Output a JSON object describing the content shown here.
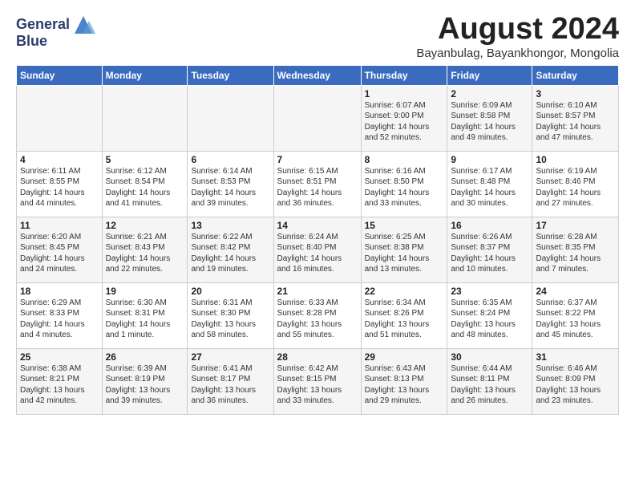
{
  "logo": {
    "general": "General",
    "blue": "Blue"
  },
  "header": {
    "month_year": "August 2024",
    "location": "Bayanbulag, Bayankhongor, Mongolia"
  },
  "days_of_week": [
    "Sunday",
    "Monday",
    "Tuesday",
    "Wednesday",
    "Thursday",
    "Friday",
    "Saturday"
  ],
  "weeks": [
    [
      {
        "day": "",
        "info": ""
      },
      {
        "day": "",
        "info": ""
      },
      {
        "day": "",
        "info": ""
      },
      {
        "day": "",
        "info": ""
      },
      {
        "day": "1",
        "info": "Sunrise: 6:07 AM\nSunset: 9:00 PM\nDaylight: 14 hours\nand 52 minutes."
      },
      {
        "day": "2",
        "info": "Sunrise: 6:09 AM\nSunset: 8:58 PM\nDaylight: 14 hours\nand 49 minutes."
      },
      {
        "day": "3",
        "info": "Sunrise: 6:10 AM\nSunset: 8:57 PM\nDaylight: 14 hours\nand 47 minutes."
      }
    ],
    [
      {
        "day": "4",
        "info": "Sunrise: 6:11 AM\nSunset: 8:55 PM\nDaylight: 14 hours\nand 44 minutes."
      },
      {
        "day": "5",
        "info": "Sunrise: 6:12 AM\nSunset: 8:54 PM\nDaylight: 14 hours\nand 41 minutes."
      },
      {
        "day": "6",
        "info": "Sunrise: 6:14 AM\nSunset: 8:53 PM\nDaylight: 14 hours\nand 39 minutes."
      },
      {
        "day": "7",
        "info": "Sunrise: 6:15 AM\nSunset: 8:51 PM\nDaylight: 14 hours\nand 36 minutes."
      },
      {
        "day": "8",
        "info": "Sunrise: 6:16 AM\nSunset: 8:50 PM\nDaylight: 14 hours\nand 33 minutes."
      },
      {
        "day": "9",
        "info": "Sunrise: 6:17 AM\nSunset: 8:48 PM\nDaylight: 14 hours\nand 30 minutes."
      },
      {
        "day": "10",
        "info": "Sunrise: 6:19 AM\nSunset: 8:46 PM\nDaylight: 14 hours\nand 27 minutes."
      }
    ],
    [
      {
        "day": "11",
        "info": "Sunrise: 6:20 AM\nSunset: 8:45 PM\nDaylight: 14 hours\nand 24 minutes."
      },
      {
        "day": "12",
        "info": "Sunrise: 6:21 AM\nSunset: 8:43 PM\nDaylight: 14 hours\nand 22 minutes."
      },
      {
        "day": "13",
        "info": "Sunrise: 6:22 AM\nSunset: 8:42 PM\nDaylight: 14 hours\nand 19 minutes."
      },
      {
        "day": "14",
        "info": "Sunrise: 6:24 AM\nSunset: 8:40 PM\nDaylight: 14 hours\nand 16 minutes."
      },
      {
        "day": "15",
        "info": "Sunrise: 6:25 AM\nSunset: 8:38 PM\nDaylight: 14 hours\nand 13 minutes."
      },
      {
        "day": "16",
        "info": "Sunrise: 6:26 AM\nSunset: 8:37 PM\nDaylight: 14 hours\nand 10 minutes."
      },
      {
        "day": "17",
        "info": "Sunrise: 6:28 AM\nSunset: 8:35 PM\nDaylight: 14 hours\nand 7 minutes."
      }
    ],
    [
      {
        "day": "18",
        "info": "Sunrise: 6:29 AM\nSunset: 8:33 PM\nDaylight: 14 hours\nand 4 minutes."
      },
      {
        "day": "19",
        "info": "Sunrise: 6:30 AM\nSunset: 8:31 PM\nDaylight: 14 hours\nand 1 minute."
      },
      {
        "day": "20",
        "info": "Sunrise: 6:31 AM\nSunset: 8:30 PM\nDaylight: 13 hours\nand 58 minutes."
      },
      {
        "day": "21",
        "info": "Sunrise: 6:33 AM\nSunset: 8:28 PM\nDaylight: 13 hours\nand 55 minutes."
      },
      {
        "day": "22",
        "info": "Sunrise: 6:34 AM\nSunset: 8:26 PM\nDaylight: 13 hours\nand 51 minutes."
      },
      {
        "day": "23",
        "info": "Sunrise: 6:35 AM\nSunset: 8:24 PM\nDaylight: 13 hours\nand 48 minutes."
      },
      {
        "day": "24",
        "info": "Sunrise: 6:37 AM\nSunset: 8:22 PM\nDaylight: 13 hours\nand 45 minutes."
      }
    ],
    [
      {
        "day": "25",
        "info": "Sunrise: 6:38 AM\nSunset: 8:21 PM\nDaylight: 13 hours\nand 42 minutes."
      },
      {
        "day": "26",
        "info": "Sunrise: 6:39 AM\nSunset: 8:19 PM\nDaylight: 13 hours\nand 39 minutes."
      },
      {
        "day": "27",
        "info": "Sunrise: 6:41 AM\nSunset: 8:17 PM\nDaylight: 13 hours\nand 36 minutes."
      },
      {
        "day": "28",
        "info": "Sunrise: 6:42 AM\nSunset: 8:15 PM\nDaylight: 13 hours\nand 33 minutes."
      },
      {
        "day": "29",
        "info": "Sunrise: 6:43 AM\nSunset: 8:13 PM\nDaylight: 13 hours\nand 29 minutes."
      },
      {
        "day": "30",
        "info": "Sunrise: 6:44 AM\nSunset: 8:11 PM\nDaylight: 13 hours\nand 26 minutes."
      },
      {
        "day": "31",
        "info": "Sunrise: 6:46 AM\nSunset: 8:09 PM\nDaylight: 13 hours\nand 23 minutes."
      }
    ]
  ]
}
